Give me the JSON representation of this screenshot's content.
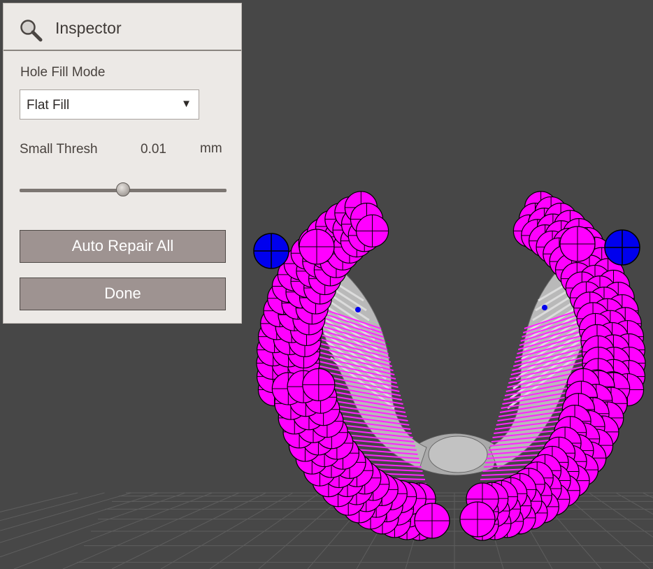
{
  "inspector": {
    "title": "Inspector",
    "icon": "search-icon",
    "hole_fill_mode_label": "Hole Fill Mode",
    "hole_fill_mode_value": "Flat Fill",
    "small_thresh_label": "Small Thresh",
    "small_thresh_value": "0.01",
    "small_thresh_unit": "mm",
    "slider_level": 0.5,
    "auto_repair_label": "Auto Repair All",
    "done_label": "Done"
  },
  "colors": {
    "viewport_background": "#474747",
    "panel_background": "#ece9e6",
    "button_background": "#9e9391",
    "hole_highlight": "#ff00ff",
    "boundary_marker": "#0000ee",
    "mesh_gray": "#b8b8b8"
  }
}
